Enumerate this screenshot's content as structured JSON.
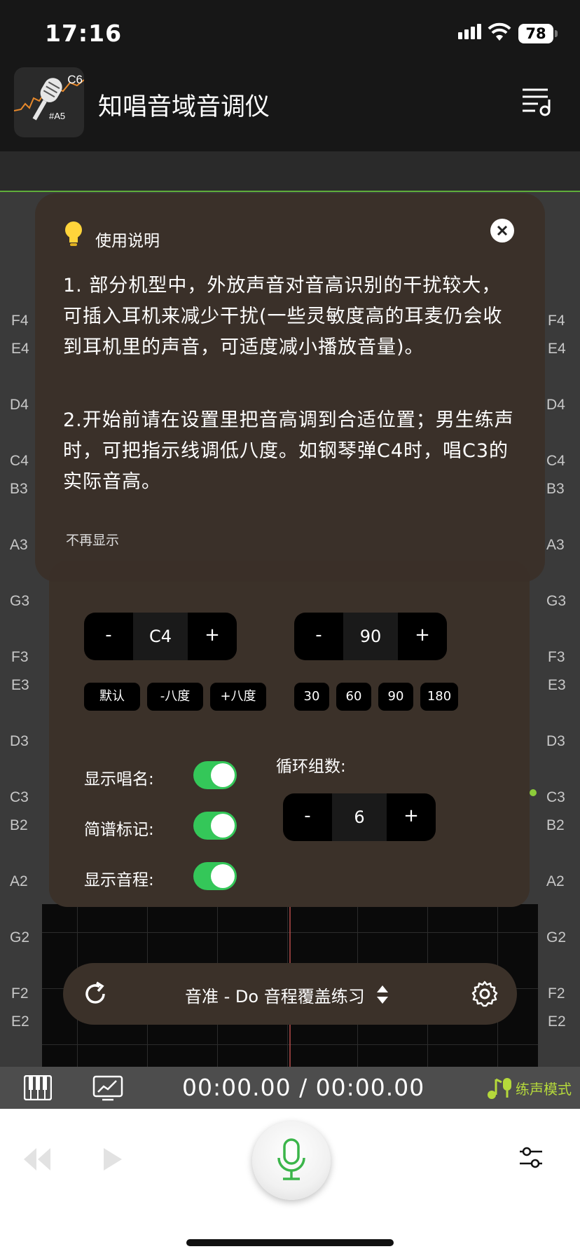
{
  "status_bar": {
    "time": "17:16",
    "battery": "78"
  },
  "header": {
    "app_title": "知唱音域音调仪",
    "logo": {
      "top_note": "C6",
      "bottom_note": "#A5"
    }
  },
  "pitch_labels_left": [
    "F4",
    "E4",
    "D4",
    "C4",
    "B3",
    "A3",
    "G3",
    "F3",
    "E3",
    "D3",
    "C3",
    "B2",
    "A2",
    "G2",
    "F2",
    "E2"
  ],
  "pitch_labels_right": [
    "F4",
    "E4",
    "D4",
    "C4",
    "B3",
    "A3",
    "G3",
    "F3",
    "E3",
    "D3",
    "C3",
    "B2",
    "A2",
    "G2",
    "F2",
    "E2"
  ],
  "dialog": {
    "title": "使用说明",
    "paragraph1": "1. 部分机型中，外放声音对音高识别的干扰较大，可插入耳机来减少干扰(一些灵敏度高的耳麦仍会收到耳机里的声音，可适度减小播放音量)。",
    "paragraph2": "2.开始前请在设置里把音高调到合适位置；男生练声时，可把指示线调低八度。如钢琴弹C4时，唱C3的实际音高。",
    "no_show": "不再显示"
  },
  "settings": {
    "key_stepper": {
      "minus": "-",
      "value": "C4",
      "plus": "+"
    },
    "key_chips": [
      "默认",
      "-八度",
      "+八度"
    ],
    "tempo_stepper": {
      "minus": "-",
      "value": "90",
      "plus": "+"
    },
    "tempo_chips": [
      "30",
      "60",
      "90",
      "180"
    ],
    "toggles": [
      {
        "label": "显示唱名:",
        "on": true
      },
      {
        "label": "简谱标记:",
        "on": true
      },
      {
        "label": "显示音程:",
        "on": true
      }
    ],
    "loop_label": "循环组数:",
    "loop_stepper": {
      "minus": "-",
      "value": "6",
      "plus": "+"
    }
  },
  "mode_bar": {
    "mode": "音准 - Do 音程覆盖练习"
  },
  "transport": {
    "timecode": "00:00.00 / 00:00.00",
    "practice_mode": "练声模式"
  },
  "colors": {
    "accent_green": "#34c759",
    "practice_label": "#b5d93b",
    "mic_green": "#3bb54a",
    "panel": "#3b3129"
  }
}
